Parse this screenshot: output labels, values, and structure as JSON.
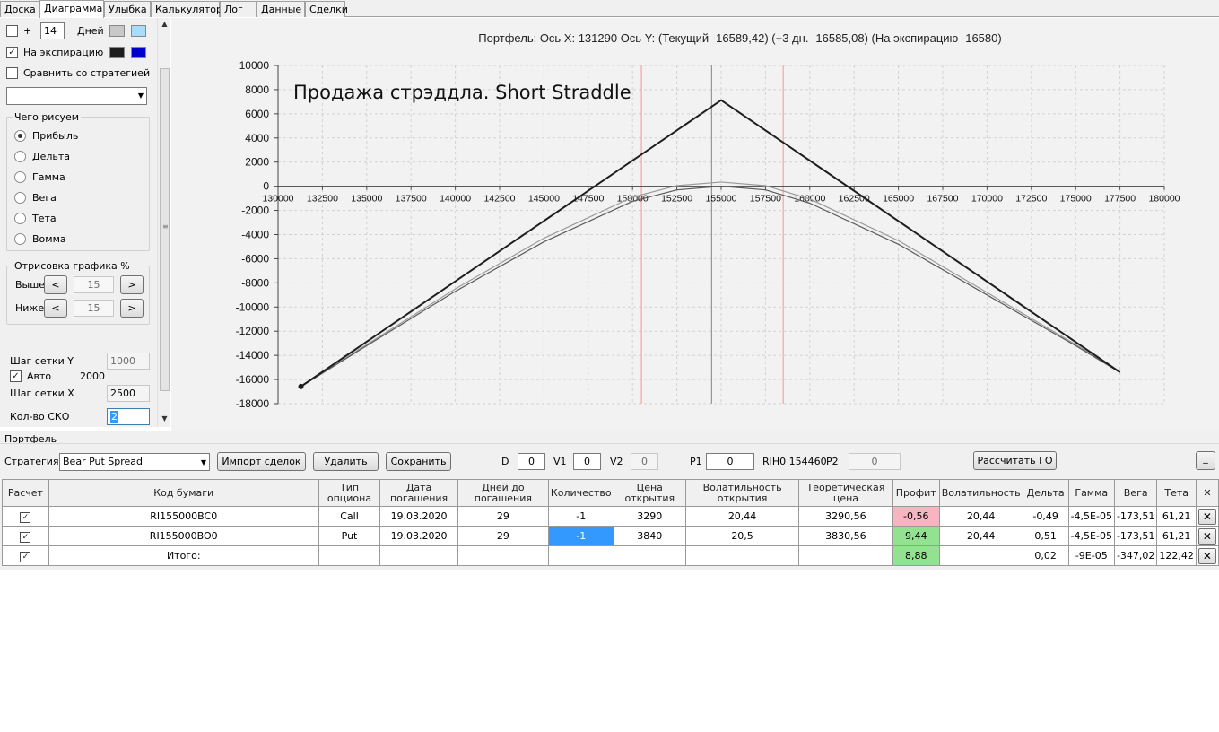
{
  "tabs": [
    "Доска",
    "Диаграмма",
    "Улыбка",
    "Калькулятор",
    "Лог",
    "Данные",
    "Сделки"
  ],
  "active_tab": "Диаграмма",
  "left": {
    "plus_label": "+",
    "days_value": "14",
    "days_label": "Дней",
    "expiration_label": "На экспирацию",
    "compare_label": "Сравнить со стратегией",
    "compare_select": "",
    "draw_group": "Чего рисуем",
    "radios": [
      "Прибыль",
      "Дельта",
      "Гамма",
      "Вега",
      "Тета",
      "Вомма"
    ],
    "selected_radio": "Прибыль",
    "render_group": "Отрисовка графика %",
    "above_label": "Выше",
    "above_value": "15",
    "below_label": "Ниже",
    "below_value": "15",
    "prev_glyph": "<",
    "next_glyph": ">",
    "grid_y_label": "Шаг сетки Y",
    "grid_y_value": "1000",
    "auto_label": "Авто",
    "auto_value": "2000",
    "grid_x_label": "Шаг сетки X",
    "grid_x_value": "2500",
    "sko_label": "Кол-во СКО",
    "sko_value": "2",
    "swatch_colors": {
      "light_gray": "#c8c8c8",
      "light_blue": "#a8dcf8",
      "black": "#1e1e1e",
      "blue": "#0000cc"
    }
  },
  "chart": {
    "header": "Портфель: Ось X: 131290 Ось Y:  (Текущий -16589,42)  (+3 дн. -16585,08)  (На экспирацию -16580)",
    "annotation": "Продажа стрэддла. Short Straddle"
  },
  "chart_data": {
    "type": "line",
    "xlim": [
      130000,
      180000
    ],
    "ylim": [
      -18000,
      10000
    ],
    "x_ticks": [
      "130000",
      "132500",
      "135000",
      "137500",
      "140000",
      "142500",
      "145000",
      "147500",
      "150000",
      "152500",
      "155000",
      "157500",
      "160000",
      "162500",
      "165000",
      "167500",
      "170000",
      "172500",
      "175000",
      "177500",
      "180000"
    ],
    "y_ticks": [
      "10000",
      "8000",
      "6000",
      "4000",
      "2000",
      "0",
      "-2000",
      "-4000",
      "-6000",
      "-8000",
      "-10000",
      "-12000",
      "-14000",
      "-16000",
      "-18000"
    ],
    "vertical_lines": [
      {
        "x": 150500,
        "color": "#ff9090"
      },
      {
        "x": 154460,
        "color": "#6e8aa0"
      },
      {
        "x": 158500,
        "color": "#ff9090"
      }
    ],
    "series": [
      {
        "color": "#1e1e1e",
        "x": [
          131290,
          155000,
          177500
        ],
        "y": [
          -16580,
          7130,
          -15400
        ]
      },
      {
        "color": "#9a9a9a",
        "x": [
          131290,
          135000,
          140000,
          145000,
          150000,
          152500,
          155000,
          157500,
          160000,
          165000,
          170000,
          175000,
          177500
        ],
        "y": [
          -16589,
          -13100,
          -8500,
          -4300,
          -900,
          50,
          350,
          50,
          -1050,
          -4500,
          -8800,
          -13100,
          -15410
        ]
      },
      {
        "color": "#5a5a5a",
        "x": [
          131290,
          135000,
          140000,
          145000,
          150000,
          152500,
          155000,
          157500,
          160000,
          165000,
          170000,
          175000,
          177500
        ],
        "y": [
          -16585,
          -13200,
          -8700,
          -4600,
          -1250,
          -300,
          0,
          -300,
          -1400,
          -4800,
          -9000,
          -13200,
          -15420
        ]
      }
    ]
  },
  "portfolio": {
    "title": "Портфель",
    "strategy_label": "Стратегия",
    "strategy_value": "Bear Put Spread",
    "import_btn": "Импорт сделок",
    "delete_btn": "Удалить",
    "save_btn": "Сохранить",
    "d_label": "D",
    "d_value": "0",
    "v1_label": "V1",
    "v1_value": "0",
    "v2_label": "V2",
    "v2_value": "0",
    "p1_label": "P1",
    "p1_value": "0",
    "instrument": "RIH0 154460",
    "p2_label": "P2",
    "p2_value": "0",
    "calc_btn": "Рассчитать ГО",
    "minimize_btn": "_"
  },
  "table": {
    "headers": [
      "Расчет",
      "Код бумаги",
      "Тип опциона",
      "Дата погашения",
      "Дней до погашения",
      "Количество",
      "Цена открытия",
      "Волатильность открытия",
      "Теоретическая цена",
      "Профит",
      "Волатильность",
      "Дельта",
      "Гамма",
      "Вега",
      "Тета",
      "✕"
    ],
    "rows": [
      {
        "check": "✓",
        "code": "RI155000BC0",
        "type": "Call",
        "date": "19.03.2020",
        "days": "29",
        "qty": "-1",
        "price": "3290",
        "vol_open": "20,44",
        "theo": "3290,56",
        "profit": "-0,56",
        "vol": "20,44",
        "delta": "-0,49",
        "gamma": "-4,5E-05",
        "vega": "-173,51",
        "theta": "61,21",
        "x": "✕"
      },
      {
        "check": "✓",
        "code": "RI155000BO0",
        "type": "Put",
        "date": "19.03.2020",
        "days": "29",
        "qty": "-1",
        "price": "3840",
        "vol_open": "20,5",
        "theo": "3830,56",
        "profit": "9,44",
        "vol": "20,44",
        "delta": "0,51",
        "gamma": "-4,5E-05",
        "vega": "-173,51",
        "theta": "61,21",
        "x": "✕"
      }
    ],
    "total": {
      "check": "✓",
      "label": "Итого:",
      "profit": "8,88",
      "delta": "0,02",
      "gamma": "-9E-05",
      "vega": "-347,02",
      "theta": "122,42",
      "x": "✕"
    },
    "colors": {
      "profit_negative": "#f8b4c0",
      "profit_positive": "#92e292",
      "selected": "#3399ff"
    }
  }
}
